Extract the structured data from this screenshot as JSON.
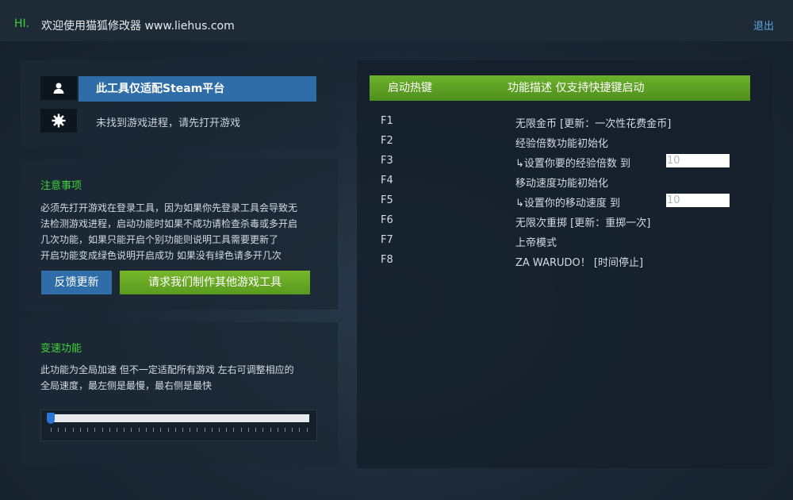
{
  "header": {
    "hi": "HI.",
    "welcome": "欢迎使用猫狐修改器 www.liehus.com",
    "logout": "退出"
  },
  "status": {
    "platform_label": "此工具仅适配Steam平台",
    "process_label": "未找到游戏进程，请先打开游戏",
    "user_icon": "user-icon",
    "gear_icon": "gear-icon"
  },
  "notes": {
    "title": "注意事项",
    "lines": [
      "必须先打开游戏在登录工具，因为如果你先登录工具会导致无",
      "法检测游戏进程，启动功能时如果不成功请检查杀毒或多开启",
      "几次功能，如果只能开启个别功能则说明工具需要更新了",
      "开启功能变成绿色说明开启成功 如果没有绿色请多开几次"
    ],
    "feedback_button": "反馈更新",
    "request_button": "请求我们制作其他游戏工具"
  },
  "speed": {
    "title": "变速功能",
    "lines": [
      "此功能为全局加速 但不一定适配所有游戏 左右可调整相应的",
      "全局速度，最左侧是最慢，最右侧是最快"
    ],
    "slider_value": 0
  },
  "hotkeys": {
    "col_key": "启动热键",
    "col_desc": "功能描述 仅支持快捷键启动",
    "rows": [
      {
        "key": "F1",
        "desc": "无限金币 [更新：一次性花费金币]"
      },
      {
        "key": "F2",
        "desc": "经验倍数功能初始化"
      },
      {
        "key": "F3",
        "desc": "↳设置你要的经验倍数 到",
        "input": "10"
      },
      {
        "key": "F4",
        "desc": "移动速度功能初始化"
      },
      {
        "key": "F5",
        "desc": "↳设置你的移动速度 到",
        "input": "10"
      },
      {
        "key": "F6",
        "desc": "无限次重掷 [更新：重掷一次]"
      },
      {
        "key": "F7",
        "desc": "上帝模式"
      },
      {
        "key": "F8",
        "desc": "ZA WARUDO！ [时间停止]"
      }
    ]
  },
  "colors": {
    "accent_green": "#3fd13a",
    "button_blue": "#2f6da8",
    "header_green": "#6cb22b",
    "link_blue": "#5ba6e0"
  }
}
